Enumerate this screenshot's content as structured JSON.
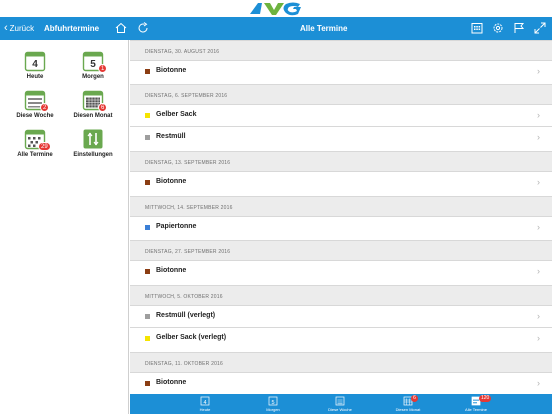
{
  "header": {
    "back_label": "Zurück",
    "left_title": "Abfuhrtermine",
    "title": "Alle Termine",
    "logo_text": "AWG"
  },
  "colors": {
    "nav_blue": "#1c8fd6",
    "biotonne": "#8b3d13",
    "gelber_sack": "#f5e400",
    "restmuell": "#9e9e9e",
    "papiertonne": "#3b7fd6",
    "badge": "#e53935",
    "tile_green": "#6aa84f"
  },
  "sidebar": {
    "tiles": [
      {
        "label": "Heute",
        "icon_text": "4",
        "badge": ""
      },
      {
        "label": "Morgen",
        "icon_text": "5",
        "badge": "1"
      },
      {
        "label": "Diese Woche",
        "icon_text": "",
        "badge": "2"
      },
      {
        "label": "Diesen Monat",
        "icon_text": "",
        "badge": "6"
      },
      {
        "label": "Alle Termine",
        "icon_text": "",
        "badge": "29"
      },
      {
        "label": "Einstellungen",
        "icon_text": "",
        "badge": ""
      }
    ]
  },
  "days": [
    {
      "date": "DIENSTAG, 30. AUGUST 2016",
      "items": [
        "Biotonne"
      ]
    },
    {
      "date": "DIENSTAG, 6. SEPTEMBER 2016",
      "items": [
        "Gelber Sack",
        "Restmüll"
      ]
    },
    {
      "date": "DIENSTAG, 13. SEPTEMBER 2016",
      "items": [
        "Biotonne"
      ]
    },
    {
      "date": "MITTWOCH, 14. SEPTEMBER 2016",
      "items": [
        "Papiertonne"
      ]
    },
    {
      "date": "DIENSTAG, 27. SEPTEMBER 2016",
      "items": [
        "Biotonne"
      ]
    },
    {
      "date": "MITTWOCH, 5. OKTOBER 2016",
      "items": [
        "Restmüll (verlegt)",
        "Gelber Sack (verlegt)"
      ]
    },
    {
      "date": "DIENSTAG, 11. OKTOBER 2016",
      "items": [
        "Biotonne"
      ]
    }
  ],
  "tabbar": {
    "tabs": [
      {
        "label": "Heute",
        "icon_text": "4",
        "badge": ""
      },
      {
        "label": "Morgen",
        "icon_text": "5",
        "badge": ""
      },
      {
        "label": "Diese Woche",
        "icon_text": "",
        "badge": ""
      },
      {
        "label": "Diesen Monat",
        "icon_text": "",
        "badge": "6"
      },
      {
        "label": "Alle Termine",
        "icon_text": "",
        "badge": "120"
      }
    ]
  }
}
